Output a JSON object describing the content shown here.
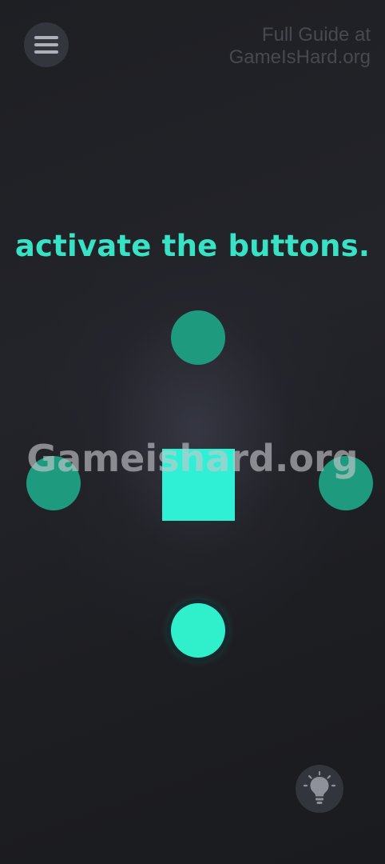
{
  "menu": {
    "icon": "hamburger-menu-icon"
  },
  "guide": {
    "line1": "Full Guide at",
    "line2": "GameIsHard.org"
  },
  "puzzle": {
    "instruction": "activate the buttons.",
    "buttons": [
      {
        "id": "top",
        "state": "inactive"
      },
      {
        "id": "left",
        "state": "inactive"
      },
      {
        "id": "right",
        "state": "inactive"
      },
      {
        "id": "bottom",
        "state": "active"
      }
    ],
    "center_block": "square"
  },
  "watermark": "Gameishard.org",
  "hint": {
    "icon": "lightbulb-icon"
  },
  "colors": {
    "background": "#1c1d21",
    "accent": "#37e3c4",
    "inactive_button": "#1e9b7e",
    "active_button": "#2ff0cb",
    "square": "#2ff0d4"
  }
}
